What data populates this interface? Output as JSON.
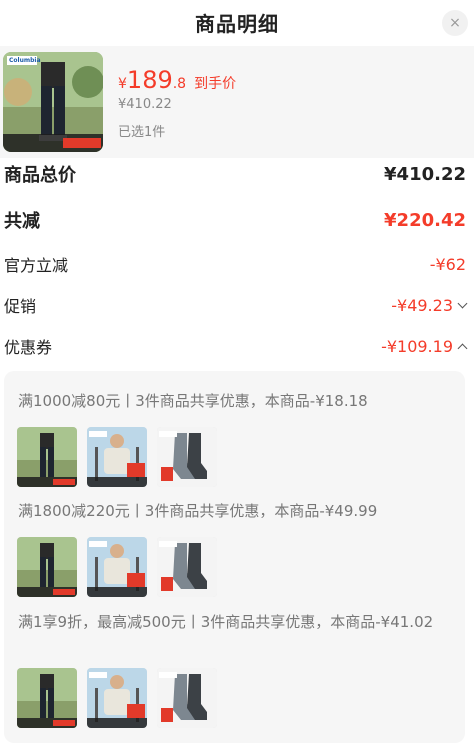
{
  "header": {
    "title": "商品明细",
    "close_label": "×"
  },
  "product": {
    "currency": "¥",
    "price_main": "189",
    "price_decimal": ".8",
    "price_tag": "到手价",
    "original_price": "¥410.22",
    "selected_count": "已选1件",
    "brand_logo": "Columbia"
  },
  "summary": {
    "total_label": "商品总价",
    "total_value": "¥410.22",
    "discount_label": "共减",
    "discount_value": "¥220.42",
    "official_label": "官方立减",
    "official_value": "-¥62",
    "promo_label": "促销",
    "promo_value": "-¥49.23",
    "coupon_label": "优惠券",
    "coupon_value": "-¥109.19"
  },
  "coupons": [
    {
      "desc": "满1000减80元丨3件商品共享优惠，本商品-¥18.18"
    },
    {
      "desc": "满1800减220元丨3件商品共享优惠，本商品-¥49.99"
    },
    {
      "desc": "满1享9折，最高减500元丨3件商品共享优惠，本商品-¥41.02"
    }
  ],
  "thumb_brand": "Columbia"
}
